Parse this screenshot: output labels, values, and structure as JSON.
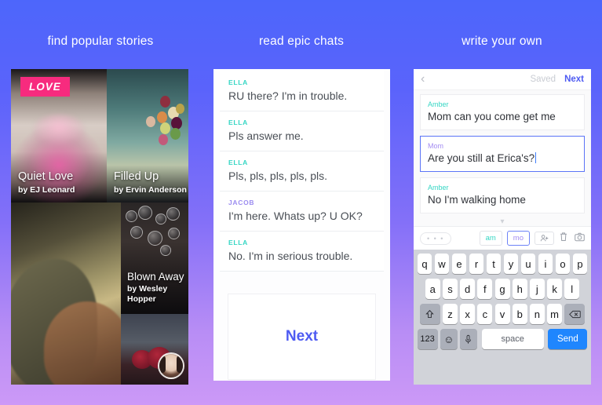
{
  "headers": {
    "find": "find popular stories",
    "read": "read epic chats",
    "write": "write your own"
  },
  "stories": {
    "badge": "LOVE",
    "cards": [
      {
        "title": "Quiet Love",
        "author": "by EJ Leonard"
      },
      {
        "title": "Filled Up",
        "author": "by Ervin Anderson"
      },
      {
        "title": "Blown Away",
        "author": "by Wesley Hopper"
      }
    ]
  },
  "chat": {
    "messages": [
      {
        "who": "ELLA",
        "text": "RU there? I'm in trouble."
      },
      {
        "who": "ELLA",
        "text": "Pls answer me."
      },
      {
        "who": "ELLA",
        "text": "Pls, pls, pls, pls, pls."
      },
      {
        "who": "JACOB",
        "text": "I'm here. Whats up? U OK?"
      },
      {
        "who": "ELLA",
        "text": "No. I'm in serious trouble."
      }
    ],
    "next_label": "Next"
  },
  "editor": {
    "nav": {
      "saved": "Saved",
      "next": "Next"
    },
    "bubbles": [
      {
        "who": "Amber",
        "text": "Mom can you come get me"
      },
      {
        "who": "Mom",
        "text": "Are you still at Erica's?"
      },
      {
        "who": "Amber",
        "text": "No I'm walking home"
      }
    ],
    "toolbar": {
      "more": "• • •",
      "tag_am": "am",
      "tag_mo": "mo",
      "add_person": "+"
    }
  },
  "keyboard": {
    "row1": [
      "q",
      "w",
      "e",
      "r",
      "t",
      "y",
      "u",
      "i",
      "o",
      "p"
    ],
    "row2": [
      "a",
      "s",
      "d",
      "f",
      "g",
      "h",
      "j",
      "k",
      "l"
    ],
    "row3": [
      "z",
      "x",
      "c",
      "v",
      "b",
      "n",
      "m"
    ],
    "numbers_label": "123",
    "emoji_label": "☺",
    "space_label": "space",
    "send_label": "Send"
  },
  "colors": {
    "bg_top": "#4d66fb",
    "bg_bottom": "#cc99f7",
    "badge_pink": "#f72b7e",
    "accent_blue": "#4e5bf2",
    "teal": "#35d6c4",
    "purple": "#a38cf2",
    "send_blue": "#1f86fe"
  }
}
